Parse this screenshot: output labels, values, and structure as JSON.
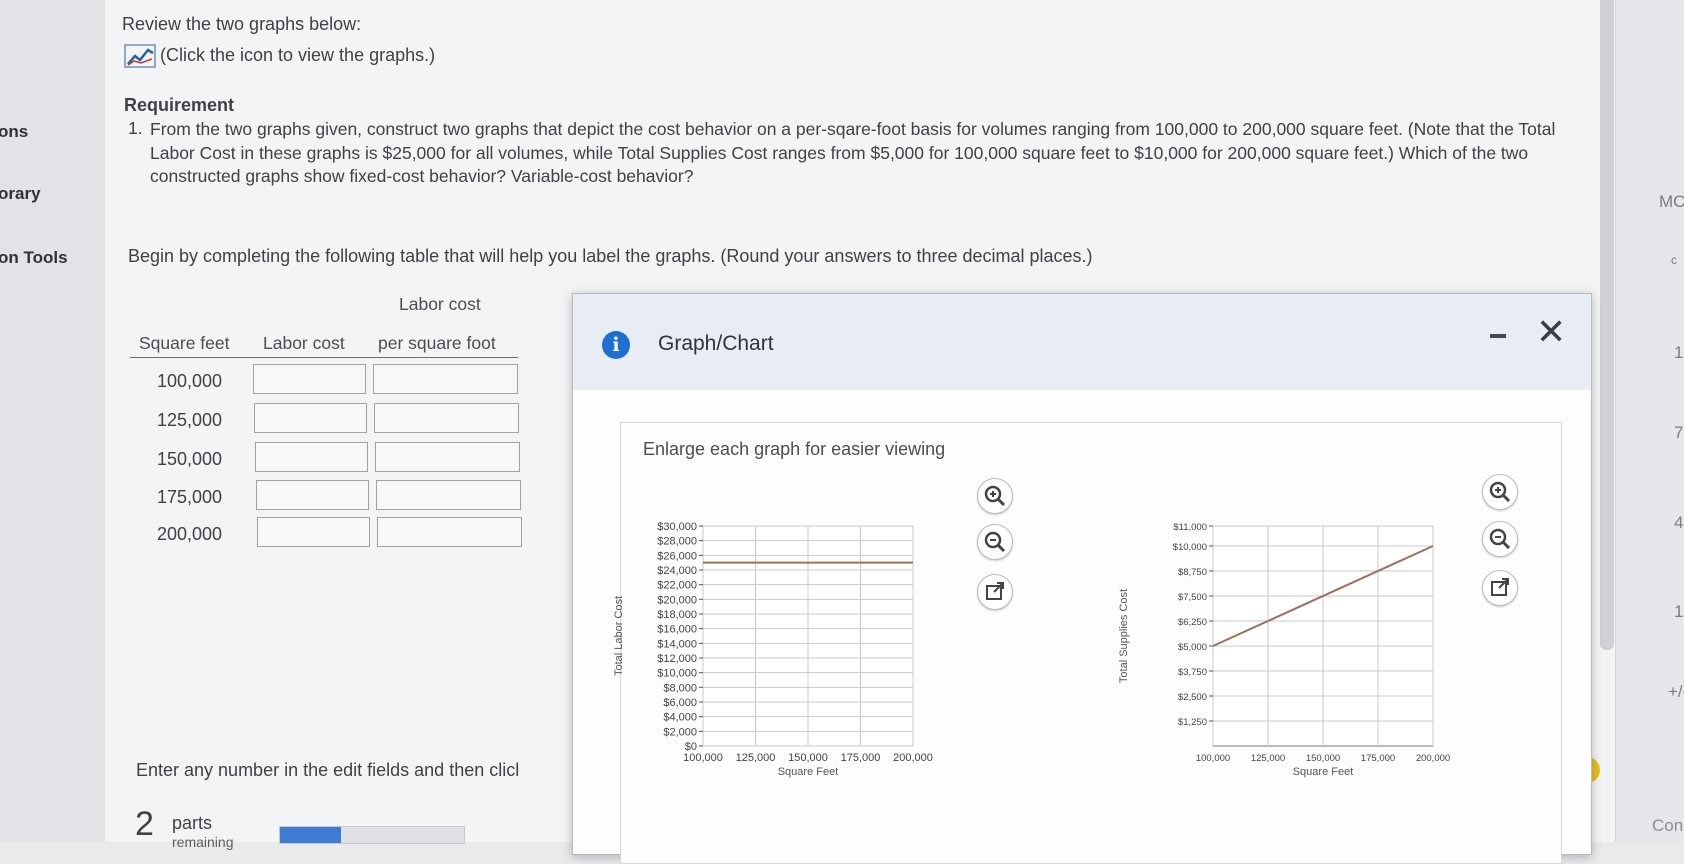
{
  "left_rail": {
    "items": [
      "ons",
      "orary",
      "on Tools"
    ]
  },
  "right_rail": {
    "items": [
      "MC",
      "c",
      "1",
      "7",
      "4",
      "1",
      "+/-"
    ]
  },
  "intro": {
    "review_text": "Review the two graphs below:",
    "click_text": "(Click the icon to view the graphs.)",
    "icon": "line-chart-icon"
  },
  "requirement": {
    "title": "Requirement",
    "number": "1.",
    "text": "From the two graphs given, construct two graphs that depict the cost behavior on a per-sqare-foot basis for volumes ranging from 100,000 to 200,000 square feet. (Note that the Total Labor Cost in these graphs is $25,000 for all volumes, while Total Supplies Cost ranges from $5,000 for 100,000 square feet to $10,000 for 200,000 square feet.) Which of the two constructed graphs show fixed-cost behavior? Variable-cost behavior?"
  },
  "instruction": "Begin by completing the following table that will help you label the graphs. (Round your answers to three decimal places.)",
  "table": {
    "group_header": "Labor cost",
    "headers": [
      "Square feet",
      "Labor cost",
      "per square foot"
    ],
    "rows": [
      "100,000",
      "125,000",
      "150,000",
      "175,000",
      "200,000"
    ]
  },
  "footer": {
    "enter_text": "Enter any number in the edit fields and then clicl",
    "parts_number": "2",
    "parts_label": "parts",
    "parts_sub": "remaining",
    "progress": 0.33,
    "corner_text": "Con"
  },
  "modal": {
    "title": "Graph/Chart",
    "enlarge_text": "Enlarge each graph for easier viewing"
  },
  "chart_data": [
    {
      "type": "line",
      "title": "",
      "xlabel": "Square Feet",
      "ylabel": "Total Labor Cost",
      "x_ticks": [
        "100,000",
        "125,000",
        "150,000",
        "175,000",
        "200,000"
      ],
      "y_ticks": [
        "$0",
        "$2,000",
        "$4,000",
        "$6,000",
        "$8,000",
        "$10,000",
        "$12,000",
        "$14,000",
        "$16,000",
        "$18,000",
        "$20,000",
        "$22,000",
        "$24,000",
        "$26,000",
        "$28,000",
        "$30,000"
      ],
      "xlim": [
        100000,
        200000
      ],
      "ylim": [
        0,
        30000
      ],
      "series": [
        {
          "x": [
            100000,
            200000
          ],
          "y": [
            25000,
            25000
          ],
          "color": "#a0705a"
        }
      ],
      "grid": true
    },
    {
      "type": "line",
      "title": "",
      "xlabel": "Square Feet",
      "ylabel": "Total Supplies Cost",
      "x_ticks": [
        "100,000",
        "125,000",
        "150,000",
        "175,000",
        "200,000"
      ],
      "y_ticks": [
        "$1,250",
        "$2,500",
        "$3,750",
        "$5,000",
        "$6,250",
        "$7,500",
        "$8,750",
        "$10,000",
        "$11,000"
      ],
      "xlim": [
        100000,
        200000
      ],
      "ylim": [
        0,
        11000
      ],
      "series": [
        {
          "x": [
            100000,
            200000
          ],
          "y": [
            5000,
            10000
          ],
          "color": "#a0705a"
        }
      ],
      "grid": true
    }
  ]
}
